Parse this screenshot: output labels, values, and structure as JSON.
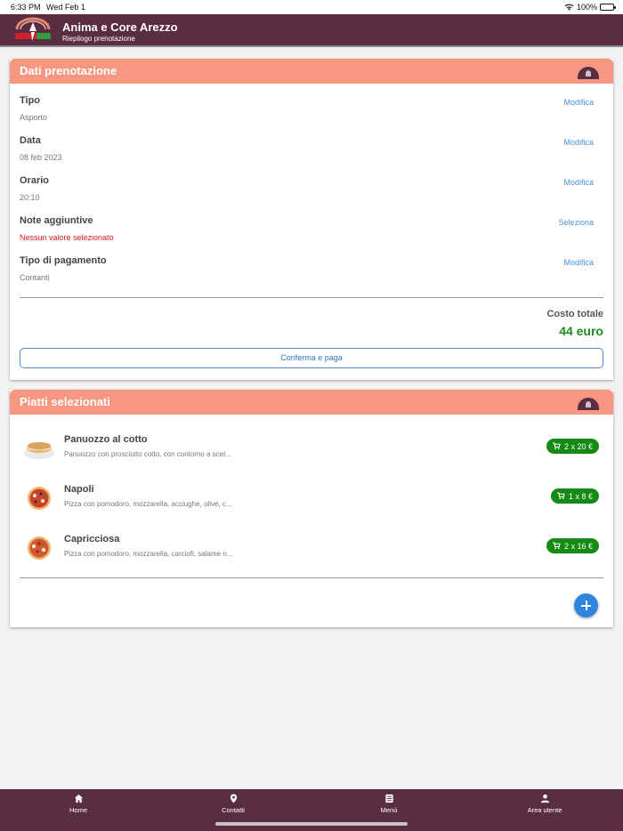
{
  "status_bar": {
    "time": "6:33 PM",
    "date": "Wed Feb 1",
    "battery": "100%"
  },
  "header": {
    "title": "Anima e Core Arezzo",
    "subtitle": "Riepilogo prenotazione"
  },
  "booking_card": {
    "title": "Dati prenotazione",
    "rows": [
      {
        "label": "Tipo",
        "value": "Asporto",
        "action": "Modifica"
      },
      {
        "label": "Data",
        "value": "08 feb 2023",
        "action": "Modifica"
      },
      {
        "label": "Orario",
        "value": "20:10",
        "action": "Modifica"
      },
      {
        "label": "Note aggiuntive",
        "value": "Nessun valore selezionato",
        "action": "Seleziona"
      },
      {
        "label": "Tipo di pagamento",
        "value": "Contanti",
        "action": "Modifica"
      }
    ],
    "total_label": "Costo totale",
    "total_value": "44 euro",
    "confirm_label": "Conferma e paga"
  },
  "dishes_card": {
    "title": "Piatti selezionati",
    "items": [
      {
        "name": "Panuozzo al cotto",
        "description": "Panuozzo con prosciutto cotto, con contorno a scel...",
        "quantity": "2 x 20 €",
        "image": "sandwich-image"
      },
      {
        "name": "Napoli",
        "description": "Pizza con pomodoro, mozzarella, acciughe, olive, c...",
        "quantity": "1 x 8 €",
        "image": "pizza-image"
      },
      {
        "name": "Capricciosa",
        "description": "Pizza con pomodoro, mozzarella, carciofi, salame n...",
        "quantity": "2 x 16 €",
        "image": "pizza-image"
      }
    ]
  },
  "bottom_nav": {
    "items": [
      {
        "label": "Home",
        "icon": "home-icon"
      },
      {
        "label": "Contatti",
        "icon": "location-pin-icon"
      },
      {
        "label": "Menù",
        "icon": "menu-book-icon"
      },
      {
        "label": "Area utente",
        "icon": "user-icon"
      }
    ]
  },
  "colors": {
    "primary": "#5b2d42",
    "card_header": "#f79782",
    "link": "#4a90d9",
    "total": "#1e8c1e",
    "badge": "#158a15",
    "warning": "#e01b1b",
    "fab": "#2f84e0"
  }
}
